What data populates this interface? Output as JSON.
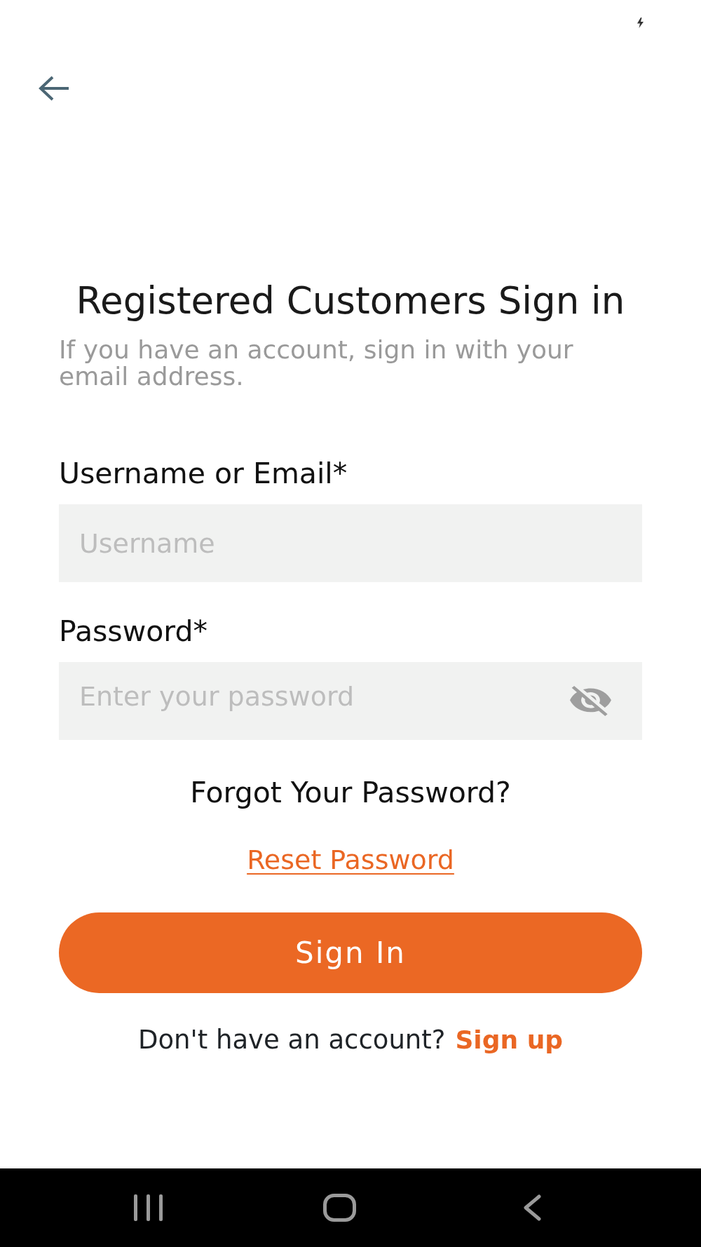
{
  "title": "Registered Customers Sign in",
  "subtitle": "If you have an account, sign in with your email address.",
  "fields": [
    {
      "kind": "text",
      "label": "Username or Email*",
      "placeholder": "Username"
    },
    {
      "kind": "password",
      "label": "Password*",
      "placeholder": "Enter your password",
      "visible": false
    }
  ],
  "forgot": {
    "prompt": "Forgot Your Password?",
    "link": "Reset Password"
  },
  "submit_button": "Sign In",
  "signup": {
    "prompt": "Don't have an account?",
    "link": "Sign up"
  }
}
